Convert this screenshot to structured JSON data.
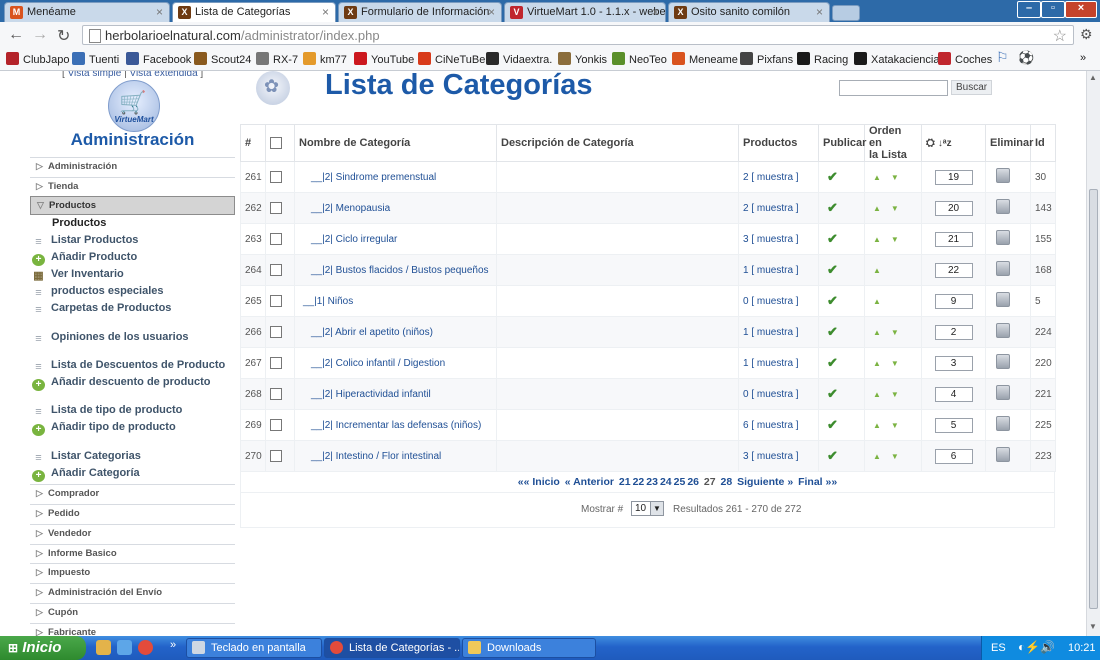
{
  "browser": {
    "tabs": [
      {
        "title": "Menéame",
        "fav_color": "#d9531e",
        "fav_glyph": "M"
      },
      {
        "title": "Lista de Categorías",
        "fav_color": "#6e3a12",
        "fav_glyph": "X",
        "active": true
      },
      {
        "title": "Formulario de Información",
        "fav_color": "#6e3a12",
        "fav_glyph": "X"
      },
      {
        "title": "VirtueMart 1.0 - 1.1.x - webe",
        "fav_color": "#c0262d",
        "fav_glyph": "V"
      },
      {
        "title": "Osito sanito comilón",
        "fav_color": "#6e3a12",
        "fav_glyph": "X"
      }
    ],
    "url_host": "herbolarioelnatural.com",
    "url_path": "/administrator/index.php",
    "bookmarks": [
      {
        "label": "ClubJapo",
        "color": "#b4232a"
      },
      {
        "label": "Tuenti",
        "color": "#3b6fb6"
      },
      {
        "label": "Facebook",
        "color": "#3b5998"
      },
      {
        "label": "Scout24",
        "color": "#8a5a1f"
      },
      {
        "label": "RX-7",
        "color": "#777777"
      },
      {
        "label": "km77",
        "color": "#e49a2b"
      },
      {
        "label": "YouTube",
        "color": "#cc181e"
      },
      {
        "label": "CiNeTuBe",
        "color": "#d83a1a"
      },
      {
        "label": "Vidaextra.",
        "color": "#2a2a2a"
      },
      {
        "label": "Yonkis",
        "color": "#8b6d3c"
      },
      {
        "label": "NeoTeo",
        "color": "#5a8f2a"
      },
      {
        "label": "Meneame",
        "color": "#d9531e"
      },
      {
        "label": "Pixfans",
        "color": "#444444"
      },
      {
        "label": "Racing",
        "color": "#1a1a1a"
      },
      {
        "label": "Xatakaciencia",
        "color": "#1a1a1a"
      },
      {
        "label": "Coches",
        "color": "#c0262d"
      }
    ]
  },
  "sidebar": {
    "view_simple": "Vista simple",
    "view_extended": "Vista extendida",
    "logo_label": "VirtueMart",
    "title": "Administración",
    "sections_top": [
      "Administración",
      "Tienda"
    ],
    "open_section": "Productos",
    "submenu_header": "Productos",
    "submenu": [
      {
        "label": "Listar Productos",
        "icon": "list"
      },
      {
        "label": "Añadir Producto",
        "icon": "add"
      },
      {
        "label": "Ver Inventario",
        "icon": "inventory"
      },
      {
        "label": "productos especiales",
        "icon": "list"
      },
      {
        "label": "Carpetas de Productos",
        "icon": "list"
      },
      {
        "label": "Opiniones de los usuarios",
        "icon": "list"
      },
      {
        "label": "Lista de Descuentos de Producto",
        "icon": "list"
      },
      {
        "label": "Añadir descuento de producto",
        "icon": "add"
      },
      {
        "label": "Lista de tipo de producto",
        "icon": "list"
      },
      {
        "label": "Añadir tipo de producto",
        "icon": "add"
      },
      {
        "label": "Listar Categorias",
        "icon": "list"
      },
      {
        "label": "Añadir Categoría",
        "icon": "add"
      }
    ],
    "sections_bottom": [
      "Comprador",
      "Pedido",
      "Vendedor",
      "Informe Basico",
      "Impuesto",
      "Administración del Envío",
      "Cupón",
      "Fabricante"
    ]
  },
  "main": {
    "title": "Lista de Categorías",
    "search_button": "Buscar",
    "columns": {
      "num": "#",
      "name": "Nombre de Categoría",
      "desc": "Descripción de Categoría",
      "products": "Productos",
      "publish": "Publicar",
      "order_line1": "Orden en",
      "order_line2": "la Lista",
      "delete": "Eliminar",
      "id": "Id"
    },
    "rows": [
      {
        "num": "261",
        "name": "__|2| Sindrome premenstual",
        "products": "2 [ muestra ]",
        "order": "19",
        "down": true,
        "id": "30"
      },
      {
        "num": "262",
        "name": "__|2| Menopausia",
        "products": "2 [ muestra ]",
        "order": "20",
        "down": true,
        "id": "143"
      },
      {
        "num": "263",
        "name": "__|2| Ciclo irregular",
        "products": "3 [ muestra ]",
        "order": "21",
        "down": true,
        "id": "155"
      },
      {
        "num": "264",
        "name": "__|2| Bustos flacidos / Bustos pequeños",
        "products": "1 [ muestra ]",
        "order": "22",
        "down": false,
        "id": "168"
      },
      {
        "num": "265",
        "name": "__|1| Niños",
        "products": "0 [ muestra ]",
        "order": "9",
        "down": false,
        "id": "5",
        "level1": true
      },
      {
        "num": "266",
        "name": "__|2| Abrir el apetito (niños)",
        "products": "1 [ muestra ]",
        "order": "2",
        "down": true,
        "id": "224"
      },
      {
        "num": "267",
        "name": "__|2| Colico infantil / Digestion",
        "products": "1 [ muestra ]",
        "order": "3",
        "down": true,
        "id": "220"
      },
      {
        "num": "268",
        "name": "__|2| Hiperactividad infantil",
        "products": "0 [ muestra ]",
        "order": "4",
        "down": true,
        "id": "221"
      },
      {
        "num": "269",
        "name": "__|2| Incrementar las defensas (niños)",
        "products": "6 [ muestra ]",
        "order": "5",
        "down": true,
        "id": "225"
      },
      {
        "num": "270",
        "name": "__|2| Intestino / Flor intestinal",
        "products": "3 [ muestra ]",
        "order": "6",
        "down": true,
        "id": "223"
      }
    ],
    "pagination": {
      "first": "«« Inicio",
      "prev": "« Anterior",
      "pages": [
        "21",
        "22",
        "23",
        "24",
        "25",
        "26",
        "27",
        "28"
      ],
      "next": "Siguiente »",
      "last": "Final »»"
    },
    "show_label": "Mostrar #",
    "show_value": "10",
    "results": "Resultados 261 - 270 de 272"
  },
  "taskbar": {
    "start": "Inicio",
    "tasks": [
      "Teclado en pantalla",
      "Lista de Categorías - ...",
      "Downloads"
    ],
    "lang": "ES",
    "clock": "10:21"
  }
}
